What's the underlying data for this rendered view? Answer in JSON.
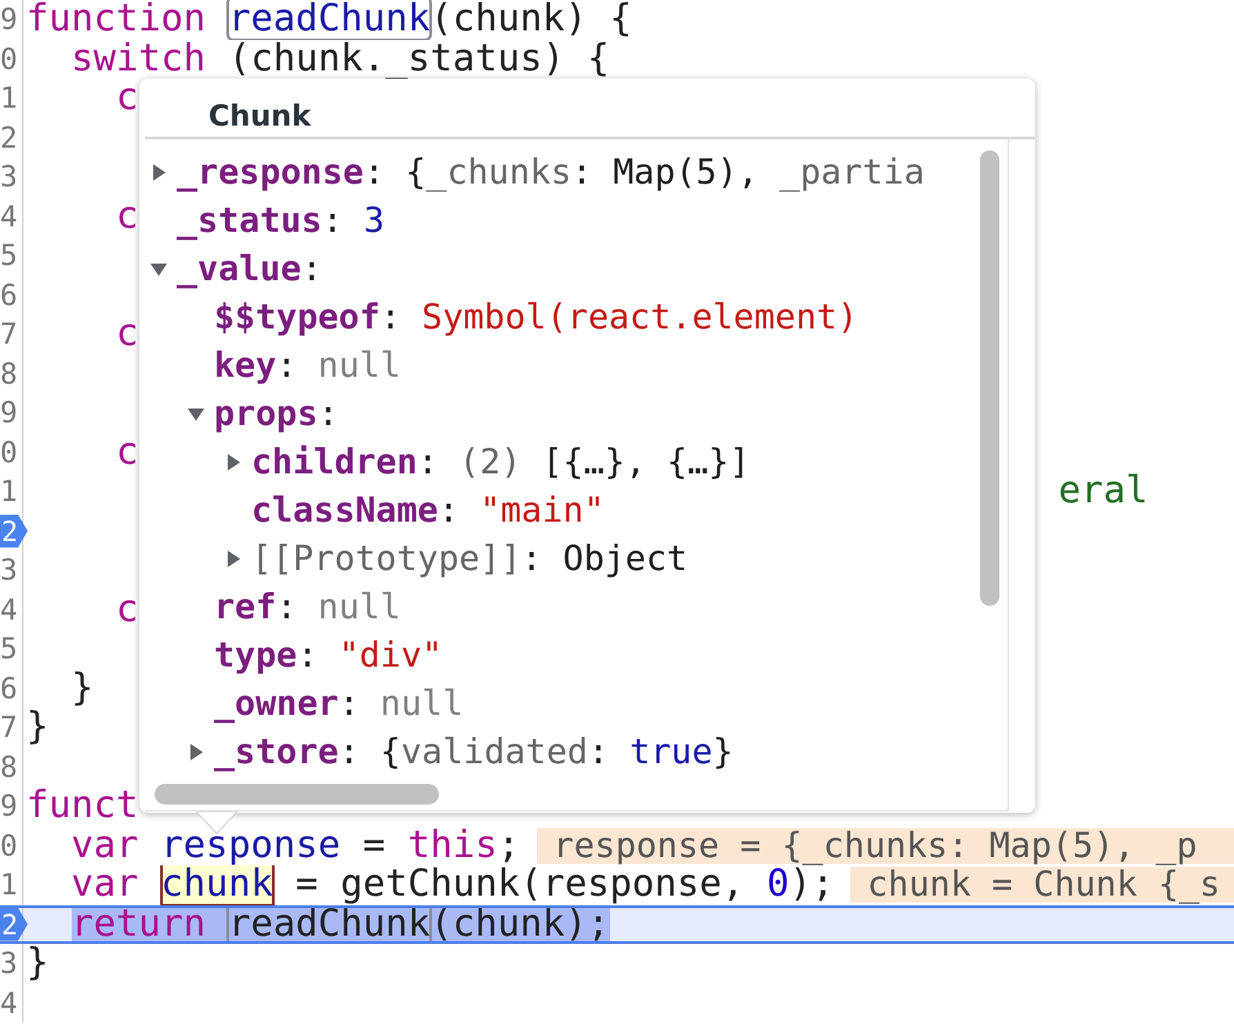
{
  "editor": {
    "lines": [
      {
        "number": "9",
        "breakpoint": false,
        "current": false,
        "segments": [
          {
            "text": "function ",
            "kind": "keyword"
          },
          {
            "text": "readChunk",
            "kind": "def",
            "outlined": true
          },
          {
            "text": "(chunk) {",
            "kind": "plain"
          }
        ]
      },
      {
        "number": "0",
        "breakpoint": false,
        "current": false,
        "segments": [
          {
            "text": "  switch",
            "kind": "keyword"
          },
          {
            "text": " (chunk._status) {",
            "kind": "plain"
          }
        ]
      },
      {
        "number": "1",
        "breakpoint": false,
        "current": false,
        "segments": [
          {
            "text": "    c",
            "kind": "keyword"
          }
        ]
      },
      {
        "number": "2",
        "breakpoint": false,
        "current": false
      },
      {
        "number": "3",
        "breakpoint": false,
        "current": false
      },
      {
        "number": "4",
        "breakpoint": false,
        "current": false,
        "segments": [
          {
            "text": "    c",
            "kind": "keyword"
          }
        ]
      },
      {
        "number": "5",
        "breakpoint": false,
        "current": false
      },
      {
        "number": "6",
        "breakpoint": false,
        "current": false
      },
      {
        "number": "7",
        "breakpoint": false,
        "current": false,
        "segments": [
          {
            "text": "    c",
            "kind": "keyword"
          }
        ]
      },
      {
        "number": "8",
        "breakpoint": false,
        "current": false
      },
      {
        "number": "9",
        "breakpoint": false,
        "current": false
      },
      {
        "number": "0",
        "breakpoint": false,
        "current": false,
        "segments": [
          {
            "text": "    c",
            "kind": "keyword"
          }
        ]
      },
      {
        "number": "1",
        "breakpoint": false,
        "current": false,
        "segments": [
          {
            "text": "                                              eral",
            "kind": "comment"
          }
        ]
      },
      {
        "number": "2",
        "breakpoint": true,
        "current": false
      },
      {
        "number": "3",
        "breakpoint": false,
        "current": false
      },
      {
        "number": "4",
        "breakpoint": false,
        "current": false,
        "segments": [
          {
            "text": "    c",
            "kind": "keyword"
          }
        ]
      },
      {
        "number": "5",
        "breakpoint": false,
        "current": false
      },
      {
        "number": "6",
        "breakpoint": false,
        "current": false,
        "segments": [
          {
            "text": "  }",
            "kind": "plain"
          }
        ]
      },
      {
        "number": "7",
        "breakpoint": false,
        "current": false,
        "segments": [
          {
            "text": "}",
            "kind": "plain"
          }
        ]
      },
      {
        "number": "8",
        "breakpoint": false,
        "current": false
      },
      {
        "number": "9",
        "breakpoint": false,
        "current": false,
        "segments": [
          {
            "text": "funct",
            "kind": "keyword"
          }
        ]
      },
      {
        "number": "0",
        "breakpoint": false,
        "current": false,
        "segments": [
          {
            "text": "  var ",
            "kind": "keyword"
          },
          {
            "text": "response",
            "kind": "def"
          },
          {
            "text": " = ",
            "kind": "plain"
          },
          {
            "text": "this",
            "kind": "keyword"
          },
          {
            "text": ";",
            "kind": "plain"
          }
        ],
        "inline_value": "response = {_chunks: Map(5), _p"
      },
      {
        "number": "1",
        "breakpoint": false,
        "current": false,
        "segments": [
          {
            "text": "  var ",
            "kind": "keyword"
          },
          {
            "text": "chunk",
            "kind": "def",
            "hovered": true
          },
          {
            "text": " = getChunk(response, ",
            "kind": "plain"
          },
          {
            "text": "0",
            "kind": "number"
          },
          {
            "text": ");",
            "kind": "plain"
          }
        ],
        "inline_value": "chunk = Chunk {_s"
      },
      {
        "number": "2",
        "breakpoint": true,
        "current": true,
        "segments": [
          {
            "text": "  return ",
            "kind": "keyword"
          },
          {
            "text": "readChunk",
            "kind": "plain",
            "outlined": true
          },
          {
            "text": "(chunk);",
            "kind": "plain"
          }
        ]
      },
      {
        "number": "3",
        "breakpoint": false,
        "current": false,
        "segments": [
          {
            "text": "}",
            "kind": "plain"
          }
        ]
      },
      {
        "number": "4",
        "breakpoint": false,
        "current": false
      }
    ]
  },
  "popup": {
    "title": "Chunk",
    "tree": [
      {
        "key": "_response",
        "expanded": false,
        "value": [
          {
            "text": ": ",
            "kind": "punct"
          },
          {
            "text": "{",
            "kind": "punct"
          },
          {
            "text": "_chunks",
            "kind": "prop"
          },
          {
            "text": ": Map(5), ",
            "kind": "punct"
          },
          {
            "text": "_partia",
            "kind": "prop"
          }
        ]
      },
      {
        "key": "_status",
        "value": [
          {
            "text": ": ",
            "kind": "punct"
          },
          {
            "text": "3",
            "kind": "number"
          }
        ]
      },
      {
        "key": "_value",
        "expanded": true,
        "value": [
          {
            "text": ":",
            "kind": "punct"
          }
        ],
        "children": [
          {
            "key": "$$typeof",
            "value": [
              {
                "text": ": ",
                "kind": "punct"
              },
              {
                "text": "Symbol(react.element)",
                "kind": "string"
              }
            ]
          },
          {
            "key": "key",
            "value": [
              {
                "text": ": ",
                "kind": "punct"
              },
              {
                "text": "null",
                "kind": "null"
              }
            ]
          },
          {
            "key": "props",
            "expanded": true,
            "value": [
              {
                "text": ":",
                "kind": "punct"
              }
            ],
            "children": [
              {
                "key": "children",
                "expanded": false,
                "value": [
                  {
                    "text": ": ",
                    "kind": "punct"
                  },
                  {
                    "text": "(2)",
                    "kind": "prop"
                  },
                  {
                    "text": " [{…}, {…}]",
                    "kind": "punct"
                  }
                ]
              },
              {
                "key": "className",
                "value": [
                  {
                    "text": ": ",
                    "kind": "punct"
                  },
                  {
                    "text": "\"main\"",
                    "kind": "string"
                  }
                ]
              },
              {
                "key": "[[Prototype]]",
                "kind": "internal",
                "expanded": false,
                "value": [
                  {
                    "text": ": ",
                    "kind": "punct"
                  },
                  {
                    "text": "Object",
                    "kind": "punct"
                  }
                ]
              }
            ]
          },
          {
            "key": "ref",
            "value": [
              {
                "text": ": ",
                "kind": "punct"
              },
              {
                "text": "null",
                "kind": "null"
              }
            ]
          },
          {
            "key": "type",
            "value": [
              {
                "text": ": ",
                "kind": "punct"
              },
              {
                "text": "\"div\"",
                "kind": "string"
              }
            ]
          },
          {
            "key": "_owner",
            "value": [
              {
                "text": ": ",
                "kind": "punct"
              },
              {
                "text": "null",
                "kind": "null"
              }
            ]
          },
          {
            "key": "_store",
            "expanded": false,
            "value": [
              {
                "text": ": ",
                "kind": "punct"
              },
              {
                "text": "{",
                "kind": "punct"
              },
              {
                "text": "validated",
                "kind": "prop"
              },
              {
                "text": ": ",
                "kind": "punct"
              },
              {
                "text": "true",
                "kind": "number"
              },
              {
                "text": "}",
                "kind": "punct"
              }
            ]
          }
        ]
      }
    ]
  }
}
